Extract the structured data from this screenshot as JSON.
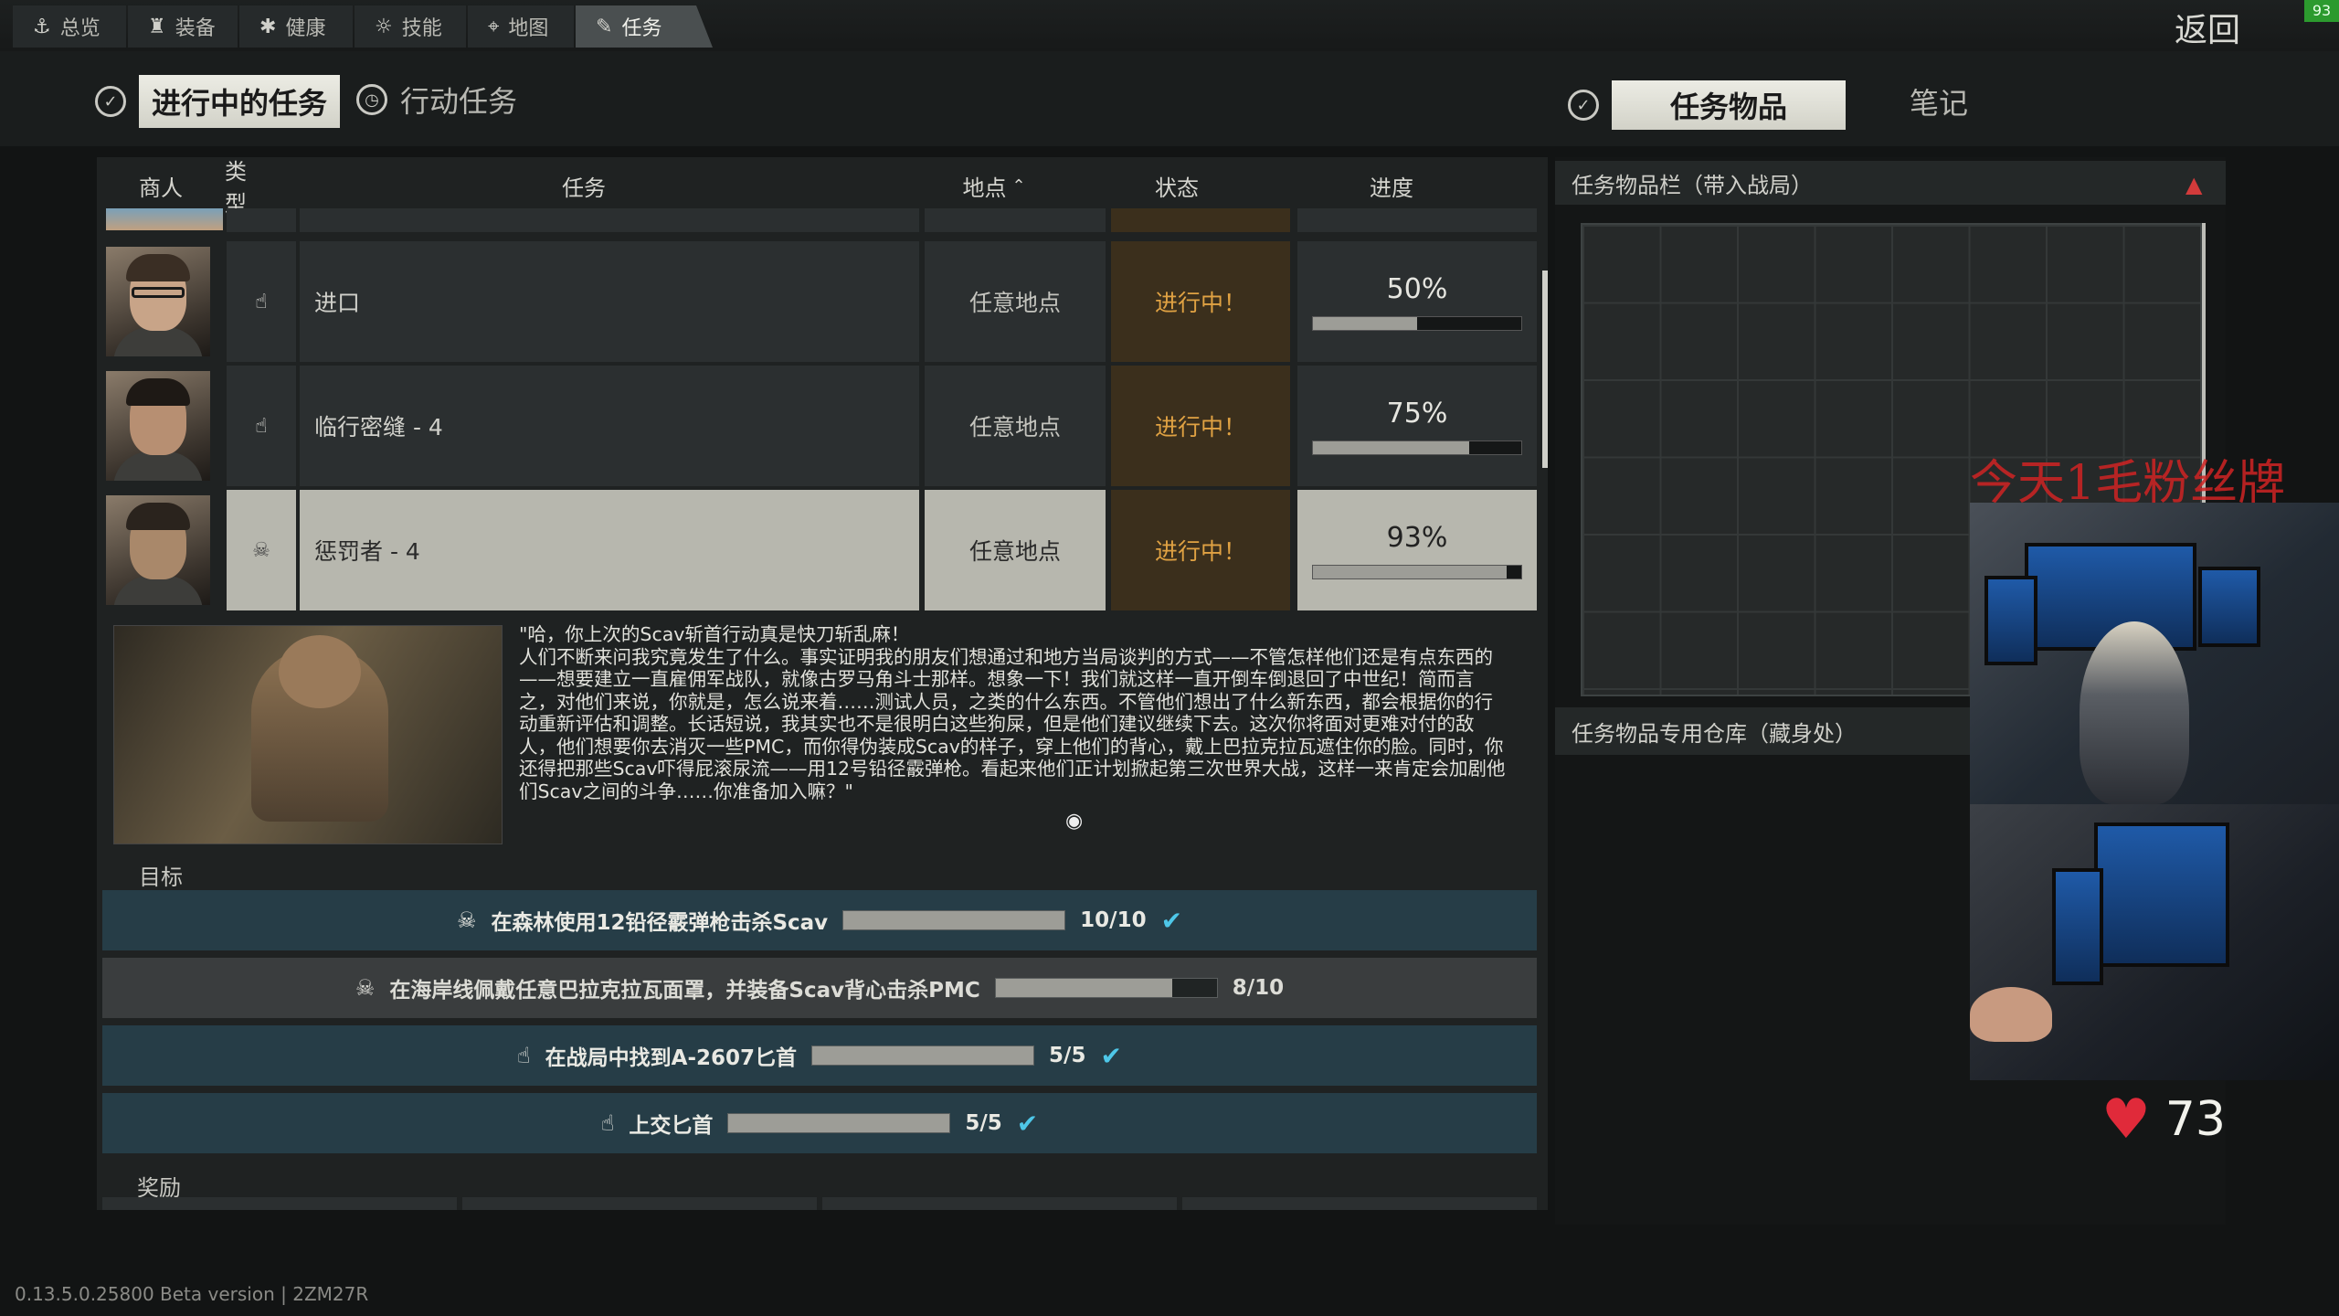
{
  "fps_badge": "93",
  "nav": {
    "tabs": [
      {
        "label": "总览",
        "icon": "anchor-icon",
        "glyph": "⚓"
      },
      {
        "label": "装备",
        "icon": "gear-doll-icon",
        "glyph": "♜"
      },
      {
        "label": "健康",
        "icon": "health-icon",
        "glyph": "✱"
      },
      {
        "label": "技能",
        "icon": "skills-icon",
        "glyph": "☼"
      },
      {
        "label": "地图",
        "icon": "map-pin-icon",
        "glyph": "⌖"
      },
      {
        "label": "任务",
        "icon": "tasks-icon",
        "glyph": "✎"
      }
    ],
    "active_tab": "任务",
    "back_label": "返回"
  },
  "subtabs": {
    "left": [
      {
        "label": "进行中的任务",
        "active": true
      },
      {
        "label": "行动任务",
        "active": false
      }
    ],
    "right": [
      {
        "label": "任务物品",
        "active": true
      },
      {
        "label": "笔记",
        "active": false
      }
    ]
  },
  "table": {
    "headers": {
      "trader": "商人",
      "type": "类型",
      "quest": "任务",
      "location": "地点",
      "status": "状态",
      "progress": "进度"
    },
    "sort_indicator": "⌃",
    "rows": [
      {
        "name": "进口",
        "location": "任意地点",
        "status": "进行中！",
        "progress_label": "50%",
        "progress": 0.5,
        "type_icon": "hand-icon",
        "type_glyph": "☝",
        "selected": false
      },
      {
        "name": "临行密缝 - 4",
        "location": "任意地点",
        "status": "进行中！",
        "progress_label": "75%",
        "progress": 0.75,
        "type_icon": "hand-icon",
        "type_glyph": "☝",
        "selected": false
      },
      {
        "name": "惩罚者 - 4",
        "location": "任意地点",
        "status": "进行中！",
        "progress_label": "93%",
        "progress": 0.93,
        "type_icon": "skull-icon",
        "type_glyph": "☠",
        "selected": true
      }
    ]
  },
  "description": "\"哈，你上次的Scav斩首行动真是快刀斩乱麻！\n人们不断来问我究竟发生了什么。事实证明我的朋友们想通过和地方当局谈判的方式——不管怎样他们还是有点东西的——想要建立一直雇佣军战队，就像古罗马角斗士那样。想象一下！我们就这样一直开倒车倒退回了中世纪！简而言之，对他们来说，你就是，怎么说来着……测试人员，之类的什么东西。不管他们想出了什么新东西，都会根据你的行动重新评估和调整。长话短说，我其实也不是很明白这些狗屎，但是他们建议继续下去。这次你将面对更难对付的敌人，他们想要你去消灭一些PMC，而你得伪装成Scav的样子，穿上他们的背心，戴上巴拉克拉瓦遮住你的脸。同时，你还得把那些Scav吓得屁滚尿流——用12号铅径霰弹枪。看起来他们正计划掀起第三次世界大战，这样一来肯定会加剧他们Scav之间的斗争……你准备加入嘛？\"",
  "objectives_label": "目标",
  "objectives": [
    {
      "text": "在森林使用12铅径霰弹枪击杀Scav",
      "count": "10/10",
      "progress": 1.0,
      "done": true,
      "icon": "skull-icon",
      "glyph": "☠"
    },
    {
      "text": "在海岸线佩戴任意巴拉克拉瓦面罩，并装备Scav背心击杀PMC",
      "count": "8/10",
      "progress": 0.8,
      "done": false,
      "icon": "skull-icon",
      "glyph": "☠"
    },
    {
      "text": "在战局中找到A-2607匕首",
      "count": "5/5",
      "progress": 1.0,
      "done": true,
      "icon": "hand-icon",
      "glyph": "☝"
    },
    {
      "text": "上交匕首",
      "count": "5/5",
      "progress": 1.0,
      "done": true,
      "icon": "hand-icon",
      "glyph": "☝"
    }
  ],
  "check_glyph": "✔",
  "rewards_label": "奖励",
  "right_panel": {
    "stash_label": "任务物品栏（带入战局）",
    "warning_glyph": "▲",
    "storage_label": "任务物品专用仓库（藏身处）"
  },
  "stream": {
    "overlay_text": "今天1毛粉丝牌",
    "heart_glyph": "♥",
    "bpm": "73"
  },
  "version": "0.13.5.0.25800 Beta version | 2ZM27R",
  "colors": {
    "status": "#e0a243",
    "check": "#4ec7e8",
    "warning": "#d23b3b",
    "overlay": "#d02424"
  }
}
